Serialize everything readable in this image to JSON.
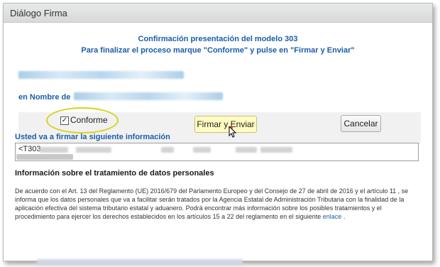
{
  "window": {
    "title": "Diálogo Firma"
  },
  "header": {
    "line1": "Confirmación presentación del modelo 303",
    "line2": "Para finalizar el proceso marque \"Conforme\" y pulse en \"Firmar y Enviar\""
  },
  "signer": {
    "en_nombre_label": "en Nombre de"
  },
  "controls": {
    "conforme_label": "Conforme",
    "conforme_checked": true,
    "firmar_label": "Firmar y Enviar",
    "cancelar_label": "Cancelar"
  },
  "info": {
    "label": "Usted va a firmar la siguiente información",
    "data_prefix": "<T303"
  },
  "privacy": {
    "heading": "Información sobre el tratamiento de datos personales",
    "text": "De acuerdo con el Art. 13 del Reglamento (UE) 2016/679 del Parlamento Europeo y del Consejo de 27 de abril de 2016 y el artículo 11 , se informa que los datos personales que va a facilitar serán tratados por la Agencia Estatal de Administración Tributaria con la finalidad de la aplicación efectiva del sistema tributario estatal y aduanero. Podrá encontrar más información sobre los posibles tratamientos y el procedimiento para ejercer los derechos establecidos en los artículos 15 a 22 del reglamento en el siguiente",
    "link_text": "enlace",
    "end": "."
  },
  "colors": {
    "accent": "#1a5ea8",
    "highlight": "#d6d41d",
    "button_focus": "#fffbc2"
  }
}
